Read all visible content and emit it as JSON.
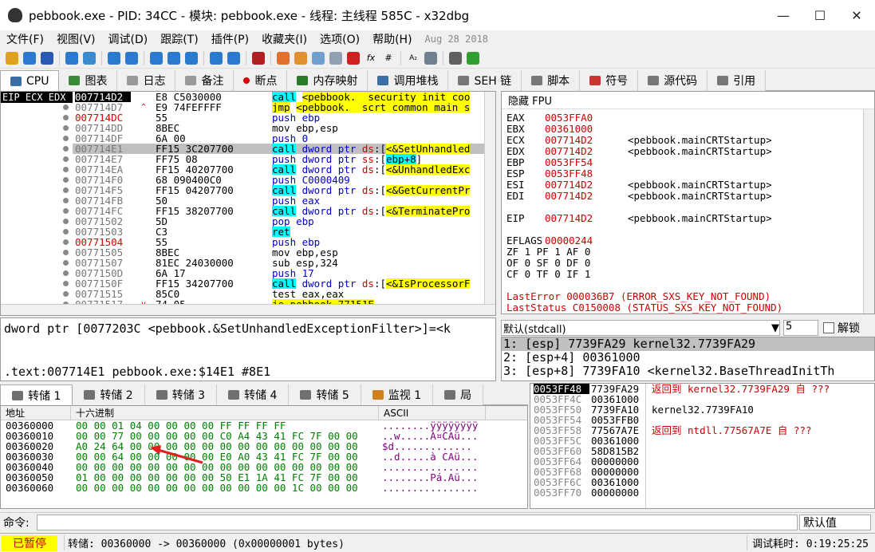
{
  "window": {
    "title": "pebbook.exe - PID: 34CC - 模块: pebbook.exe - 线程: 主线程 585C - x32dbg"
  },
  "menu": {
    "items": [
      "文件(F)",
      "视图(V)",
      "调试(D)",
      "跟踪(T)",
      "插件(P)",
      "收藏夹(I)",
      "选项(O)",
      "帮助(H)"
    ],
    "date": "Aug 28 2018"
  },
  "tabs": [
    {
      "label": "CPU",
      "color": "#3a6ea5"
    },
    {
      "label": "图表",
      "color": "#3a8a3a"
    },
    {
      "label": "日志",
      "color": "#777"
    },
    {
      "label": "备注",
      "color": "#777"
    },
    {
      "label": "断点",
      "color": "#d00"
    },
    {
      "label": "内存映射",
      "color": "#2a7a2a"
    },
    {
      "label": "调用堆栈",
      "color": "#3a6ea5"
    },
    {
      "label": "SEH 链",
      "color": "#555"
    },
    {
      "label": "脚本",
      "color": "#555"
    },
    {
      "label": "符号",
      "color": "#c33"
    },
    {
      "label": "源代码",
      "color": "#555"
    },
    {
      "label": "引用",
      "color": "#555"
    }
  ],
  "disasm": {
    "eip_label": "EIP ECX EDX",
    "rows": [
      {
        "addr": "007714D2",
        "addr_style": "cur",
        "mark": "",
        "bytes": "E8 C5030000",
        "ins": [
          [
            "call",
            "hl-call"
          ],
          [
            " ",
            ""
          ],
          [
            "<pebbook.__security_init_coo",
            "hl-yel"
          ]
        ]
      },
      {
        "addr": "007714D7",
        "addr_style": "",
        "mark": "^",
        "bytes": "E9 74FEFFFF",
        "ins": [
          [
            "jmp",
            "hl-jmp"
          ],
          [
            " ",
            ""
          ],
          [
            "<pebbook.__scrt_common_main_s",
            "hl-yel"
          ]
        ]
      },
      {
        "addr": "007714DC",
        "addr_style": "red",
        "mark": "",
        "bytes": "55",
        "ins": [
          [
            "push ebp",
            "kw-b"
          ]
        ]
      },
      {
        "addr": "007714DD",
        "addr_style": "",
        "mark": "",
        "bytes": "8BEC",
        "ins": [
          [
            "mov ebp,esp",
            ""
          ]
        ]
      },
      {
        "addr": "007714DF",
        "addr_style": "",
        "mark": "",
        "bytes": "6A 00",
        "ins": [
          [
            "push 0",
            "kw-b"
          ]
        ]
      },
      {
        "addr": "007714E1",
        "addr_style": "",
        "mark": "",
        "bytes": "FF15 3C207700",
        "sel": true,
        "ins": [
          [
            "call",
            "hl-call"
          ],
          [
            " dword ptr ",
            "kw-b"
          ],
          [
            "ds",
            "kw-r"
          ],
          [
            ":[",
            ""
          ],
          [
            "<&SetUnhandled",
            "hl-yel"
          ]
        ]
      },
      {
        "addr": "007714E7",
        "addr_style": "",
        "mark": "",
        "bytes": "FF75 08",
        "ins": [
          [
            "push dword ptr ",
            "kw-b"
          ],
          [
            "ss",
            "kw-r"
          ],
          [
            ":[",
            ""
          ],
          [
            "ebp+8",
            "hl-call"
          ],
          [
            "]",
            ""
          ]
        ]
      },
      {
        "addr": "007714EA",
        "addr_style": "",
        "mark": "",
        "bytes": "FF15 40207700",
        "ins": [
          [
            "call",
            "hl-call"
          ],
          [
            " dword ptr ",
            "kw-b"
          ],
          [
            "ds",
            "kw-r"
          ],
          [
            ":[",
            ""
          ],
          [
            "<&UnhandledExc",
            "hl-yel"
          ]
        ]
      },
      {
        "addr": "007714F0",
        "addr_style": "",
        "mark": "",
        "bytes": "68 090400C0",
        "ins": [
          [
            "push C0000409",
            "kw-b"
          ]
        ]
      },
      {
        "addr": "007714F5",
        "addr_style": "",
        "mark": "",
        "bytes": "FF15 04207700",
        "ins": [
          [
            "call",
            "hl-call"
          ],
          [
            " dword ptr ",
            "kw-b"
          ],
          [
            "ds",
            "kw-r"
          ],
          [
            ":[",
            ""
          ],
          [
            "<&GetCurrentPr",
            "hl-yel"
          ]
        ]
      },
      {
        "addr": "007714FB",
        "addr_style": "",
        "mark": "",
        "bytes": "50",
        "ins": [
          [
            "push eax",
            "kw-b"
          ]
        ]
      },
      {
        "addr": "007714FC",
        "addr_style": "",
        "mark": "",
        "bytes": "FF15 38207700",
        "ins": [
          [
            "call",
            "hl-call"
          ],
          [
            " dword ptr ",
            "kw-b"
          ],
          [
            "ds",
            "kw-r"
          ],
          [
            ":[",
            ""
          ],
          [
            "<&TerminatePro",
            "hl-yel"
          ]
        ]
      },
      {
        "addr": "00771502",
        "addr_style": "",
        "mark": "",
        "bytes": "5D",
        "ins": [
          [
            "pop ebp",
            "kw-b"
          ]
        ]
      },
      {
        "addr": "00771503",
        "addr_style": "",
        "mark": "",
        "bytes": "C3",
        "ins": [
          [
            "ret",
            "hl-call"
          ]
        ]
      },
      {
        "addr": "00771504",
        "addr_style": "red",
        "mark": "",
        "bytes": "55",
        "ins": [
          [
            "push ebp",
            "kw-b"
          ]
        ]
      },
      {
        "addr": "00771505",
        "addr_style": "",
        "mark": "",
        "bytes": "8BEC",
        "ins": [
          [
            "mov ebp,esp",
            ""
          ]
        ]
      },
      {
        "addr": "00771507",
        "addr_style": "",
        "mark": "",
        "bytes": "81EC 24030000",
        "ins": [
          [
            "sub esp,324",
            ""
          ]
        ]
      },
      {
        "addr": "0077150D",
        "addr_style": "",
        "mark": "",
        "bytes": "6A 17",
        "ins": [
          [
            "push 17",
            "kw-b"
          ]
        ]
      },
      {
        "addr": "0077150F",
        "addr_style": "",
        "mark": "",
        "bytes": "FF15 34207700",
        "ins": [
          [
            "call",
            "hl-call"
          ],
          [
            " dword ptr ",
            "kw-b"
          ],
          [
            "ds",
            "kw-r"
          ],
          [
            ":[",
            ""
          ],
          [
            "<&IsProcessorF",
            "hl-yel"
          ]
        ]
      },
      {
        "addr": "00771515",
        "addr_style": "",
        "mark": "",
        "bytes": "85C0",
        "ins": [
          [
            "test eax,eax",
            ""
          ]
        ]
      },
      {
        "addr": "00771517",
        "addr_style": "",
        "mark": "v",
        "bytes": "74 05",
        "ins": [
          [
            "je pebbook.77151E",
            "hl-jmp"
          ]
        ]
      }
    ]
  },
  "info": {
    "line1": "dword ptr [0077203C <pebbook.&SetUnhandledExceptionFilter>]=<k",
    "line2": ".text:007714E1 pebbook.exe:$14E1 #8E1"
  },
  "regs": {
    "header": "隐藏 FPU",
    "rows": [
      {
        "name": "EAX",
        "value": "0053FFA0",
        "comment": ""
      },
      {
        "name": "EBX",
        "value": "00361000",
        "comment": ""
      },
      {
        "name": "ECX",
        "value": "007714D2",
        "comment": "<pebbook.mainCRTStartup>"
      },
      {
        "name": "EDX",
        "value": "007714D2",
        "comment": "<pebbook.mainCRTStartup>"
      },
      {
        "name": "EBP",
        "value": "0053FF54",
        "comment": ""
      },
      {
        "name": "ESP",
        "value": "0053FF48",
        "comment": ""
      },
      {
        "name": "ESI",
        "value": "007714D2",
        "comment": "<pebbook.mainCRTStartup>"
      },
      {
        "name": "EDI",
        "value": "007714D2",
        "comment": "<pebbook.mainCRTStartup>"
      },
      {
        "name": "",
        "value": "",
        "comment": ""
      },
      {
        "name": "EIP",
        "value": "007714D2",
        "comment": "<pebbook.mainCRTStartup>"
      },
      {
        "name": "",
        "value": "",
        "comment": ""
      },
      {
        "name": "EFLAGS",
        "value": "00000244",
        "comment": ""
      }
    ],
    "flags": [
      "ZF 1  PF 1  AF 0",
      "OF 0  SF 0  DF 0",
      "CF 0  TF 0  IF 1"
    ],
    "last_error": "LastError  000036B7 (ERROR_SXS_KEY_NOT_FOUND)",
    "last_status": "LastStatus C0150008 (STATUS_SXS_KEY_NOT_FOUND)"
  },
  "callconv": {
    "select": "默认(stdcall)",
    "count": "5",
    "unlock_label": "解锁"
  },
  "args": [
    "1: [esp] 7739FA29 kernel32.7739FA29",
    "2: [esp+4] 00361000",
    "3: [esp+8] 7739FA10 <kernel32.BaseThreadInitTh"
  ],
  "dump": {
    "tabs": [
      "转储 1",
      "转储 2",
      "转储 3",
      "转储 4",
      "转储 5",
      "监视 1",
      "局"
    ],
    "col_addr": "地址",
    "col_hex": "十六进制",
    "col_ascii": "ASCII",
    "rows": [
      {
        "addr": "00360000",
        "hex": "00 00 01 04 00 00 00 00  FF FF FF FF",
        "ascii": "........ÿÿÿÿÿÿÿÿ"
      },
      {
        "addr": "00360010",
        "hex": "00 00 77 00 00 00 00 00  C0 A4 43 41 FC 7F 00 00",
        "ascii": "..w.....À¤CAü..."
      },
      {
        "addr": "00360020",
        "hex": "A0 24 64 00 00 00 00 00  00 00 00 00 00 00 00 00",
        "ascii": " $d............."
      },
      {
        "addr": "00360030",
        "hex": "00 00 64 00 00 00 00 00  E0 A0 43 41 FC 7F 00 00",
        "ascii": "..d.....à CAü..."
      },
      {
        "addr": "00360040",
        "hex": "00 00 00 00 00 00 00 00  00 00 00 00 00 00 00 00",
        "ascii": "................"
      },
      {
        "addr": "00360050",
        "hex": "01 00 00 00 00 00 00 00  50 E1 1A 41 FC 7F 00 00",
        "ascii": "........Pá.Aü..."
      },
      {
        "addr": "00360060",
        "hex": "00 00 00 00 00 00 00 00  00 00 00 00 1C 00 00 00",
        "ascii": "................"
      }
    ]
  },
  "stack": {
    "rows": [
      {
        "addr": "0053FF48",
        "cur": true,
        "val": "7739FA29",
        "comment": "返回到 kernel32.7739FA29 自 ???",
        "black": false
      },
      {
        "addr": "0053FF4C",
        "cur": false,
        "val": "00361000",
        "comment": "",
        "black": false
      },
      {
        "addr": "0053FF50",
        "cur": false,
        "val": "7739FA10",
        "comment": "kernel32.7739FA10",
        "black": true
      },
      {
        "addr": "0053FF54",
        "cur": false,
        "val": "0053FFB0",
        "comment": "",
        "black": false
      },
      {
        "addr": "0053FF58",
        "cur": false,
        "val": "77567A7E",
        "comment": "返回到 ntdll.77567A7E 自 ???",
        "black": false
      },
      {
        "addr": "0053FF5C",
        "cur": false,
        "val": "00361000",
        "comment": "",
        "black": false
      },
      {
        "addr": "0053FF60",
        "cur": false,
        "val": "58D815B2",
        "comment": "",
        "black": false
      },
      {
        "addr": "0053FF64",
        "cur": false,
        "val": "00000000",
        "comment": "",
        "black": false
      },
      {
        "addr": "0053FF68",
        "cur": false,
        "val": "00000000",
        "comment": "",
        "black": false
      },
      {
        "addr": "0053FF6C",
        "cur": false,
        "val": "00361000",
        "comment": "",
        "black": false
      },
      {
        "addr": "0053FF70",
        "cur": false,
        "val": "00000000",
        "comment": "",
        "black": false
      }
    ]
  },
  "command": {
    "label": "命令:",
    "default": "默认值"
  },
  "status": {
    "paused": "已暂停",
    "message": "转储: 00360000 -> 00360000 (0x00000001 bytes)",
    "time": "调试耗时: 0:19:25:25"
  }
}
